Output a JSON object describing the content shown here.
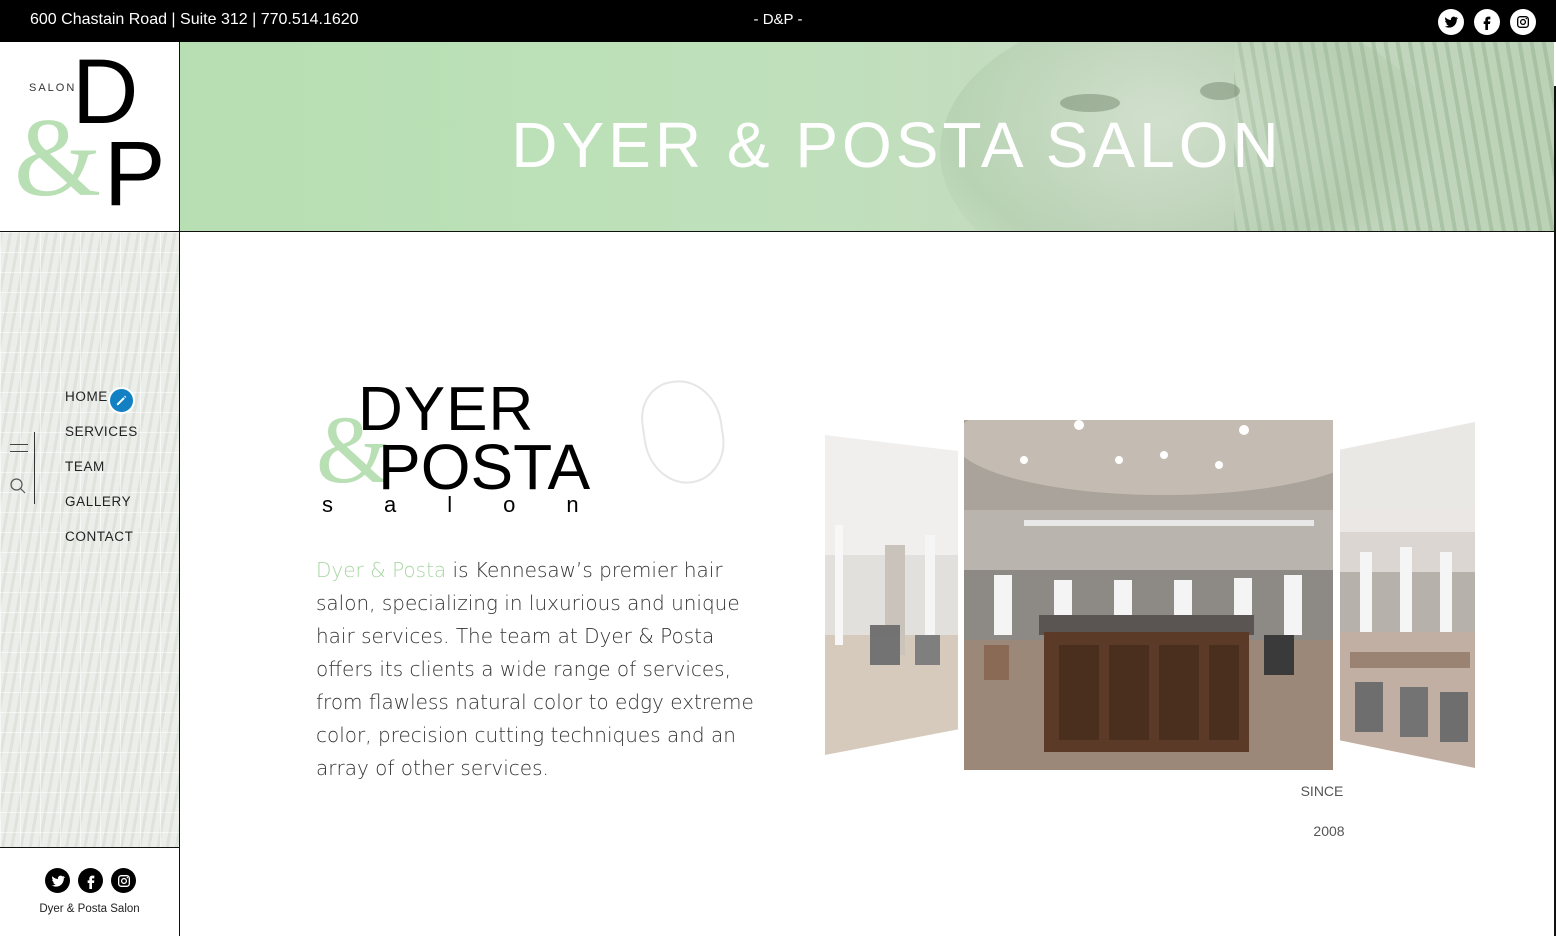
{
  "topbar": {
    "address": "600 Chastain Road | Suite 312 | 770.514.1620",
    "center_mark": "- D&P -",
    "social": [
      "twitter-icon",
      "facebook-icon",
      "instagram-icon"
    ]
  },
  "sidebar": {
    "logo": {
      "salon_word": "SALON",
      "d": "D",
      "amp": "&",
      "p": "P"
    },
    "nav": [
      "HOME",
      "SERVICES",
      "TEAM",
      "GALLERY",
      "CONTACT"
    ],
    "footer_name": "Dyer & Posta Salon"
  },
  "hero": {
    "title": "DYER & POSTA SALON"
  },
  "brand": {
    "line1": "DYER",
    "amp": "&",
    "line2": "POSTA",
    "line3": "salon",
    "since_label": "SINCE",
    "since_year": "2008"
  },
  "intro": {
    "highlight": "Dyer & Posta",
    "text": " is Kennesaw’s premier hair salon, specializing in luxurious and unique hair services. The team at Dyer & Posta offers its clients a wide range of services, from flawless natural color to edgy extreme color, precision cutting techniques and an array of other services."
  },
  "colors": {
    "accent": "#b9dfb4",
    "edit_badge": "#1380c3",
    "topbar": "#000000"
  }
}
